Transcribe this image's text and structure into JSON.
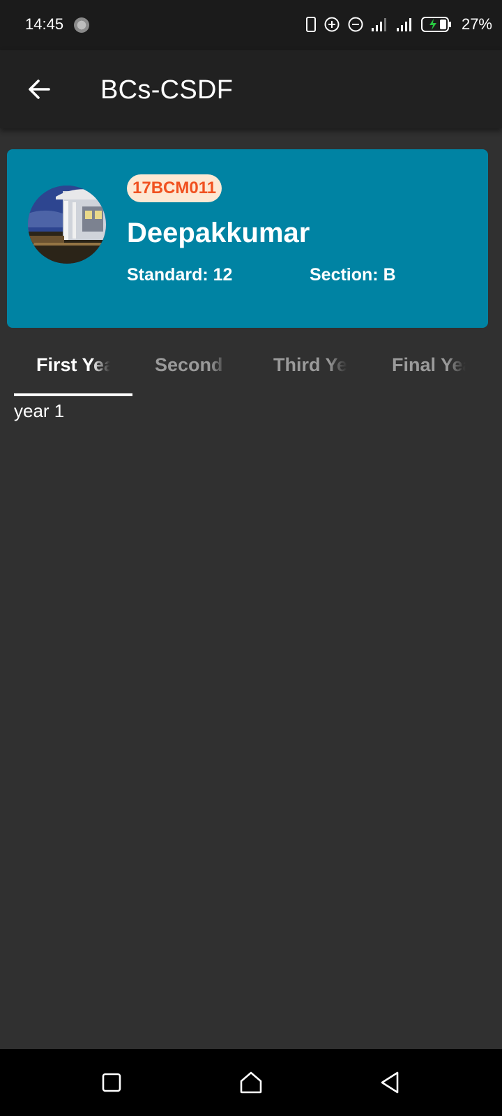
{
  "status_bar": {
    "time": "14:45",
    "battery_percent": "27%",
    "icons": [
      "loading-dot-icon",
      "phone-outline-icon",
      "data-saver-plus-icon",
      "dnd-minus-icon",
      "signal-icon",
      "signal-icon",
      "battery-charging-icon"
    ]
  },
  "app_bar": {
    "title": "BCs-CSDF",
    "back_icon": "arrow-back-icon"
  },
  "profile_card": {
    "student_id": "17BCM011",
    "name": "Deepakkumar",
    "standard": "Standard: 12",
    "section": "Section: B",
    "accent_color": "#0083a3",
    "badge_text_color": "#f0511f"
  },
  "tabs": [
    {
      "label": "First Year",
      "active": true
    },
    {
      "label": "Second Year",
      "active": false
    },
    {
      "label": "Third Year",
      "active": false
    },
    {
      "label": "Final Year",
      "active": false
    }
  ],
  "tab_content": {
    "text": "year 1"
  },
  "nav_bar": {
    "icons": [
      "recents-square-icon",
      "home-icon",
      "back-triangle-icon"
    ]
  }
}
